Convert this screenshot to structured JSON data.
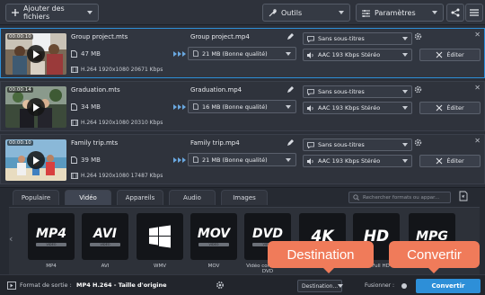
{
  "toolbar": {
    "add_files_label": "Ajouter des fichiers",
    "tools_label": "Outils",
    "settings_label": "Paramètres"
  },
  "files": [
    {
      "duration": "00:00:10",
      "name": "Group project.mts",
      "size": "47 MB",
      "info": "H.264 1920x1080 20671 Kbps",
      "output_name": "Group project.mp4",
      "output_size": "21 MB (Bonne qualité)",
      "subtitles": "Sans sous-titres",
      "audio": "AAC 193 Kbps Stéréo",
      "edit_label": "Éditer",
      "selected": true
    },
    {
      "duration": "00:00:14",
      "name": "Graduation.mts",
      "size": "34 MB",
      "info": "H.264 1920x1080 20310 Kbps",
      "output_name": "Graduation.mp4",
      "output_size": "16 MB (Bonne qualité)",
      "subtitles": "Sans sous-titres",
      "audio": "AAC 193 Kbps Stéréo",
      "edit_label": "Éditer",
      "selected": false
    },
    {
      "duration": "00:00:10",
      "name": "Family trip.mts",
      "size": "39 MB",
      "info": "H.264 1920x1080 17487 Kbps",
      "output_name": "Family trip.mp4",
      "output_size": "21 MB (Bonne qualité)",
      "subtitles": "Sans sous-titres",
      "audio": "AAC 193 Kbps Stéréo",
      "edit_label": "Éditer",
      "selected": false
    }
  ],
  "tabs": [
    "Populaire",
    "Vidéo",
    "Appareils",
    "Audio",
    "Images"
  ],
  "active_tab": "Vidéo",
  "format_search_placeholder": "Rechercher formats ou appar...",
  "formats": [
    {
      "big": "MP4",
      "bar": "VIDEO",
      "label": "MP4"
    },
    {
      "big": "AVI",
      "bar": "VIDEO",
      "label": "AVI"
    },
    {
      "big": "WMV",
      "bar": "",
      "label": "WMV"
    },
    {
      "big": "MOV",
      "bar": "VIDEO",
      "label": "MOV"
    },
    {
      "big": "DVD",
      "bar": "VIDEO",
      "label": "Vidéo compatible DVD"
    },
    {
      "big": "4K",
      "bar": "",
      "label": "4K"
    },
    {
      "big": "HD",
      "bar": "",
      "label": "HD Full HD"
    },
    {
      "big": "MPG",
      "bar": "",
      "label": "MPG"
    }
  ],
  "bottom": {
    "output_format_label": "Format de sortie :",
    "output_format_value": "MP4 H.264 - Taille d'origine",
    "destination_label": "Destination...",
    "merge_label": "Fusionner :",
    "convert_label": "Convertir"
  },
  "callouts": {
    "destination": "Destination",
    "convert": "Convertir"
  },
  "colors": {
    "accent": "#2d8fd8",
    "callout": "#f07b5a",
    "background": "#2b2f38"
  }
}
